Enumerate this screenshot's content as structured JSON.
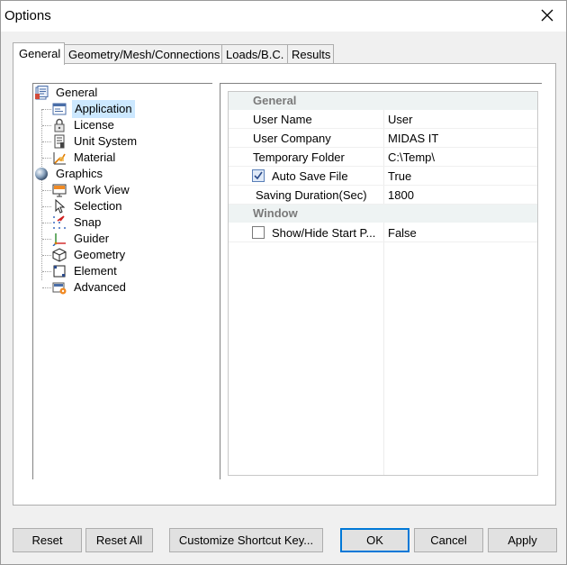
{
  "window": {
    "title": "Options"
  },
  "tabs": [
    {
      "label": "General"
    },
    {
      "label": "Geometry/Mesh/Connections"
    },
    {
      "label": "Loads/B.C."
    },
    {
      "label": "Results"
    }
  ],
  "tree": {
    "general": {
      "label": "General",
      "children": [
        {
          "label": "Application"
        },
        {
          "label": "License"
        },
        {
          "label": "Unit System"
        },
        {
          "label": "Material"
        }
      ]
    },
    "graphics": {
      "label": "Graphics",
      "children": [
        {
          "label": "Work View"
        },
        {
          "label": "Selection"
        },
        {
          "label": "Snap"
        },
        {
          "label": "Guider"
        },
        {
          "label": "Geometry"
        },
        {
          "label": "Element"
        },
        {
          "label": "Advanced"
        }
      ]
    }
  },
  "properties": {
    "general_category": "General",
    "window_category": "Window",
    "rows": [
      {
        "name": "User Name",
        "value": "User"
      },
      {
        "name": "User Company",
        "value": "MIDAS IT"
      },
      {
        "name": "Temporary Folder",
        "value": "C:\\Temp\\"
      },
      {
        "name": "Auto Save File",
        "value": "True",
        "checked": true
      },
      {
        "name": "Saving Duration(Sec)",
        "value": "1800"
      },
      {
        "name": "Show/Hide Start P...",
        "value": "False",
        "checked": false
      }
    ]
  },
  "buttons": {
    "reset": "Reset",
    "reset_all": "Reset All",
    "customize": "Customize Shortcut Key...",
    "ok": "OK",
    "cancel": "Cancel",
    "apply": "Apply"
  },
  "colors": {
    "accent": "#0078d7",
    "selection": "#cce8ff",
    "category_bg": "#eef3f3"
  }
}
